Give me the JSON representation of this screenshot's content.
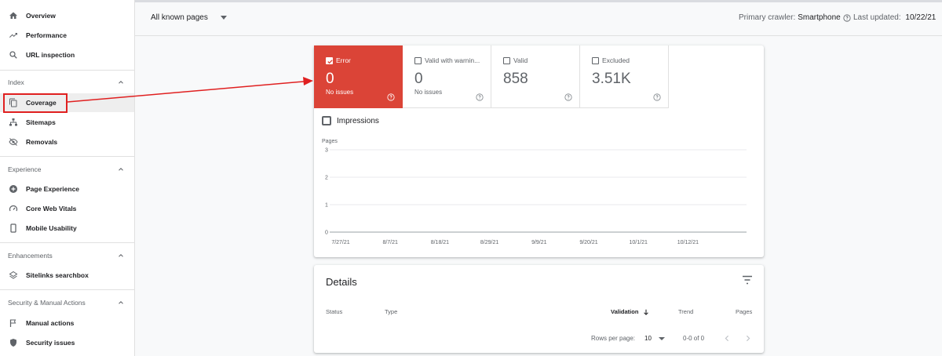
{
  "sidebar": {
    "top_items": [
      {
        "label": "Overview",
        "icon": "home-icon"
      },
      {
        "label": "Performance",
        "icon": "trending-icon"
      },
      {
        "label": "URL inspection",
        "icon": "search-icon"
      }
    ],
    "sections": [
      {
        "title": "Index",
        "items": [
          {
            "label": "Coverage",
            "icon": "file-copy-icon"
          },
          {
            "label": "Sitemaps",
            "icon": "sitemap-icon"
          },
          {
            "label": "Removals",
            "icon": "eye-off-icon"
          }
        ]
      },
      {
        "title": "Experience",
        "items": [
          {
            "label": "Page Experience",
            "icon": "plus-circle-icon"
          },
          {
            "label": "Core Web Vitals",
            "icon": "speedometer-icon"
          },
          {
            "label": "Mobile Usability",
            "icon": "phone-icon"
          }
        ]
      },
      {
        "title": "Enhancements",
        "items": [
          {
            "label": "Sitelinks searchbox",
            "icon": "layers-icon"
          }
        ]
      },
      {
        "title": "Security & Manual Actions",
        "items": [
          {
            "label": "Manual actions",
            "icon": "flag-icon"
          },
          {
            "label": "Security issues",
            "icon": "shield-icon"
          }
        ]
      }
    ]
  },
  "topbar": {
    "filter_label": "All known pages",
    "crawler_label": "Primary crawler:",
    "crawler_value": "Smartphone",
    "updated_label": "Last updated:",
    "updated_value": "10/22/21"
  },
  "tiles": [
    {
      "label": "Error",
      "value": "0",
      "sub": "No issues",
      "checked": true
    },
    {
      "label": "Valid with warnin...",
      "value": "0",
      "sub": "No issues",
      "checked": false
    },
    {
      "label": "Valid",
      "value": "858",
      "sub": "",
      "checked": false
    },
    {
      "label": "Excluded",
      "value": "3.51K",
      "sub": "",
      "checked": false
    }
  ],
  "impressions_label": "Impressions",
  "chart_data": {
    "type": "line",
    "ylabel": "Pages",
    "y_ticks": [
      "3",
      "2",
      "1",
      "0"
    ],
    "x_ticks": [
      "7/27/21",
      "8/7/21",
      "8/18/21",
      "8/29/21",
      "9/9/21",
      "9/20/21",
      "10/1/21",
      "10/12/21"
    ],
    "ylim": [
      0,
      3
    ],
    "series": [
      {
        "name": "Error",
        "values": [
          0,
          0,
          0,
          0,
          0,
          0,
          0,
          0
        ]
      }
    ],
    "grid": true
  },
  "details": {
    "title": "Details",
    "columns": {
      "status": "Status",
      "type": "Type",
      "validation": "Validation",
      "trend": "Trend",
      "pages": "Pages"
    },
    "rows_per_page_label": "Rows per page:",
    "rows_per_page_value": "10",
    "range": "0-0 of 0"
  },
  "colors": {
    "error": "#db4437",
    "annotation": "#e02020"
  }
}
